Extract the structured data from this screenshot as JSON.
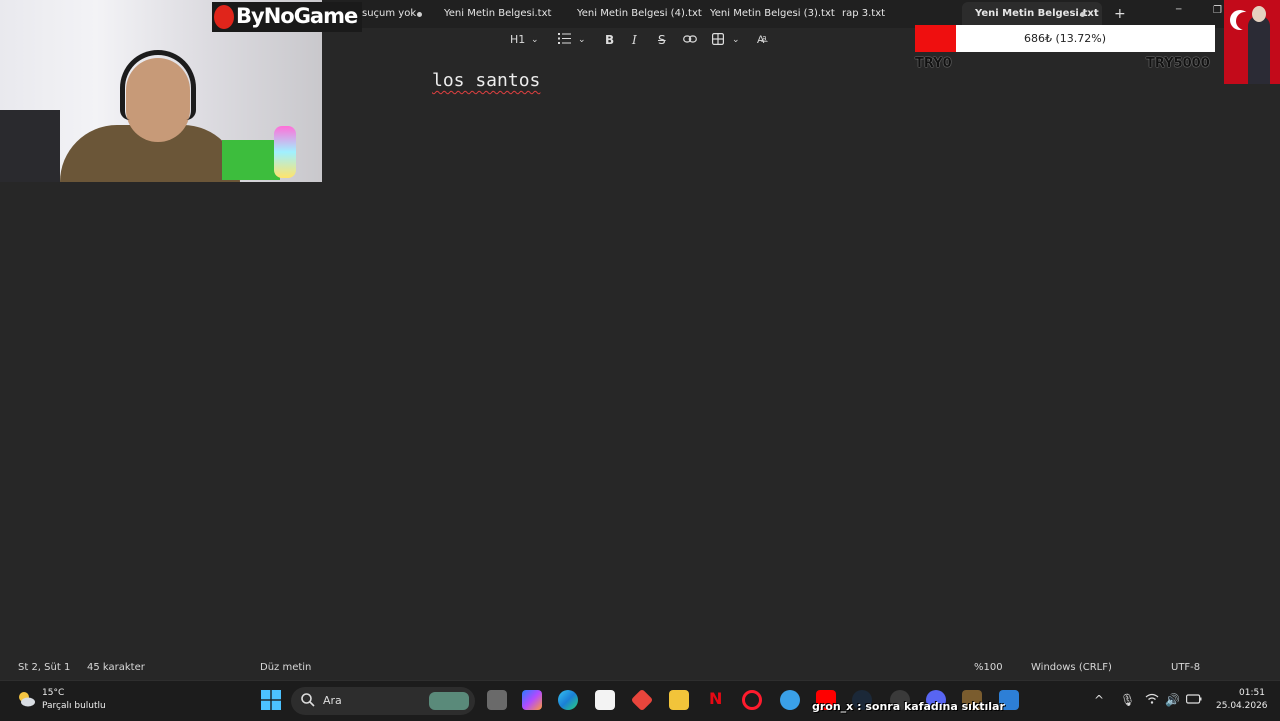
{
  "overlay": {
    "logo_text": "ByNoGame",
    "donation": {
      "label": "686₺ (13.72%)",
      "progress_fraction": 0.1372,
      "min_label": "TRY0",
      "max_label": "TRY5000",
      "fill_color": "#ef0f0f"
    },
    "chat_message": "gron_x : sonra kafadına sıktılar"
  },
  "tabs": [
    {
      "label": "suçum yok"
    },
    {
      "label": "Yeni Metin Belgesi.txt"
    },
    {
      "label": "Yeni Metin Belgesi (4).txt"
    },
    {
      "label": "Yeni Metin Belgesi (3).txt"
    },
    {
      "label": "rap 3.txt"
    },
    {
      "label": "Yeni Metin Belgesi.txt"
    }
  ],
  "window_controls": {
    "new_tab": "+",
    "minimize": "─",
    "restore": "❐"
  },
  "toolbar": {
    "heading": "H1",
    "list_icon": "list-icon",
    "bold": "B",
    "italic": "I",
    "strike": "S",
    "link_icon": "link-icon",
    "table_icon": "table-icon",
    "spell_icon": "spellcheck-icon"
  },
  "document": {
    "text": "los santos"
  },
  "status": {
    "position": "St 2, Süt 1",
    "chars": "45 karakter",
    "format": "Düz metin",
    "zoom": "%100",
    "line_endings": "Windows (CRLF)",
    "encoding": "UTF-8"
  },
  "taskbar": {
    "weather_temp": "15°C",
    "weather_desc": "Parçalı bulutlu",
    "search_placeholder": "Ara",
    "time": "01:51",
    "date": "25.04.2026"
  }
}
